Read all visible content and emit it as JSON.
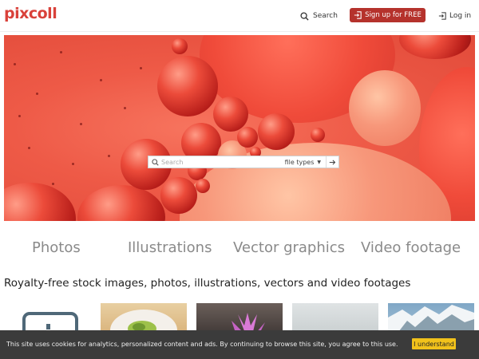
{
  "header": {
    "logo": "pixcoll",
    "search_label": "Search",
    "signup_label": "Sign up for FREE",
    "login_label": "Log in"
  },
  "hero": {
    "search_placeholder": "Search",
    "filetypes_label": "file types"
  },
  "categories": [
    "Photos",
    "Illustrations",
    "Vector graphics",
    "Video footage"
  ],
  "headline": "Royalty-free stock images, photos, illustrations, vectors and video footages",
  "cookie": {
    "text": "This site uses cookies for analytics, personalized content and ads. By continuing to browse this site, you agree to this use.",
    "button": "I understand"
  },
  "colors": {
    "brand": "#d9413a",
    "signup_bg": "#b5322c",
    "cookie_bg": "#3b3b3b",
    "cookie_button": "#f2c21b"
  }
}
